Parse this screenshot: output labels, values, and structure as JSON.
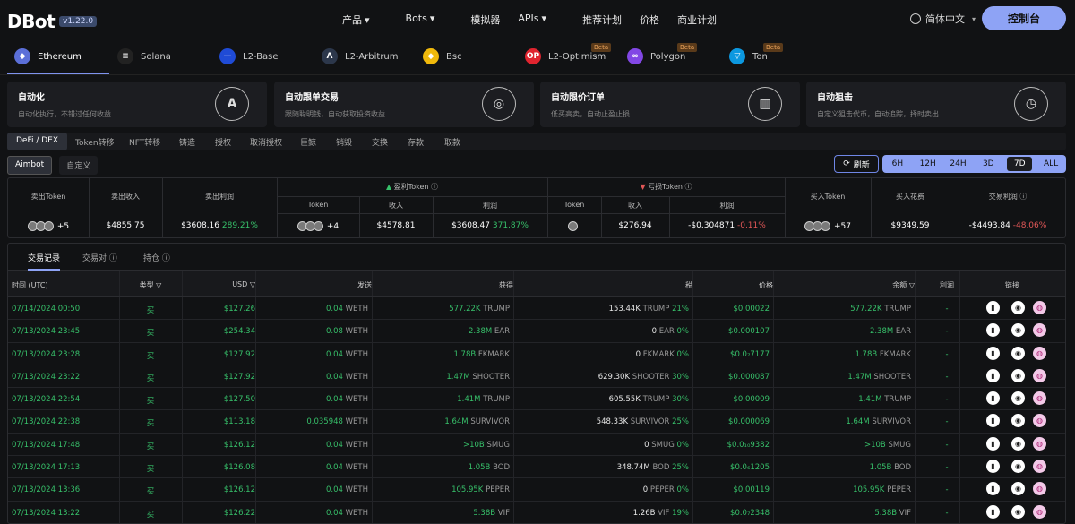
{
  "brand": {
    "name": "DBot",
    "version": "v1.22.0"
  },
  "nav": {
    "items": [
      "产品",
      "Bots",
      "模拟器",
      "APIs",
      "推荐计划",
      "价格",
      "商业计划"
    ],
    "lang": "简体中文",
    "console": "控制台"
  },
  "chains": [
    {
      "label": "Ethereum",
      "color": "#5b6fd8",
      "glyph": "◆",
      "beta": ""
    },
    {
      "label": "Solana",
      "color": "#222",
      "glyph": "≡",
      "beta": ""
    },
    {
      "label": "L2-Base",
      "color": "#1f4bd6",
      "glyph": "—",
      "beta": ""
    },
    {
      "label": "L2-Arbitrum",
      "color": "#2c374b",
      "glyph": "Λ",
      "beta": ""
    },
    {
      "label": "Bsc",
      "color": "#f0b90b",
      "glyph": "◆",
      "beta": ""
    },
    {
      "label": "L2-Optimism",
      "color": "#e0242f",
      "glyph": "OP",
      "beta": "Beta"
    },
    {
      "label": "Polygon",
      "color": "#8247e5",
      "glyph": "∞",
      "beta": "Beta"
    },
    {
      "label": "Ton",
      "color": "#0c98e0",
      "glyph": "▽",
      "beta": "Beta"
    }
  ],
  "cards": [
    {
      "title": "自动化",
      "desc": "自动化执行，不错过任何收益",
      "icon": "A"
    },
    {
      "title": "自动跟单交易",
      "desc": "跟随聪明钱，自动获取投资收益",
      "icon": "◎"
    },
    {
      "title": "自动限价订单",
      "desc": "低买高卖，自动止盈止损",
      "icon": "▥"
    },
    {
      "title": "自动狙击",
      "desc": "自定义狙击代币，自动追踪，择时卖出",
      "icon": "◷"
    }
  ],
  "tabs1": [
    "DeFi / DEX",
    "Token转移",
    "NFT转移",
    "铸造",
    "授权",
    "取消授权",
    "巨鲸",
    "销毁",
    "交换",
    "存款",
    "取款"
  ],
  "tabs2": [
    "Aimbot",
    "自定义"
  ],
  "refresh": "刷新",
  "time": [
    "6H",
    "12H",
    "24H",
    "3D",
    "7D",
    "ALL"
  ],
  "stats": {
    "h": {
      "sell_token": "卖出Token",
      "sell_income": "卖出收入",
      "sell_profit": "卖出利润",
      "profit_token": "盈利Token",
      "loss_token": "亏损Token",
      "token": "Token",
      "income": "收入",
      "profit": "利润",
      "buy_token": "买入Token",
      "buy_cost": "买入花费",
      "trade_profit": "交易利润"
    },
    "v": {
      "sell_token_more": "+5",
      "sell_income": "$4855.75",
      "sell_profit": "$3608.16",
      "sell_profit_pct": "289.21%",
      "p_token_more": "+4",
      "p_income": "$4578.81",
      "p_profit": "$3608.47",
      "p_profit_pct": "371.87%",
      "l_income": "$276.94",
      "l_profit": "-$0.304871",
      "l_profit_pct": "-0.11%",
      "buy_more": "+57",
      "buy_cost": "$9349.59",
      "trade_profit": "-$4493.84",
      "trade_profit_pct": "-48.06%"
    }
  },
  "ttabs": [
    "交易记录",
    "交易对",
    "持仓"
  ],
  "cols": [
    "时间 (UTC)",
    "类型",
    "USD",
    "发送",
    "获得",
    "税",
    "价格",
    "余额",
    "利润",
    "链接"
  ],
  "rows": [
    [
      "07/14/2024 00:50",
      "买",
      "$127.26",
      "0.04",
      "WETH",
      "577.22K",
      "TRUMP",
      "153.44K",
      "TRUMP",
      "21%",
      "$0.00022",
      "577.22K",
      "TRUMP",
      "-"
    ],
    [
      "07/13/2024 23:45",
      "买",
      "$254.34",
      "0.08",
      "WETH",
      "2.38M",
      "EAR",
      "0",
      "EAR",
      "0%",
      "$0.000107",
      "2.38M",
      "EAR",
      "-"
    ],
    [
      "07/13/2024 23:28",
      "买",
      "$127.92",
      "0.04",
      "WETH",
      "1.78B",
      "FKMARK",
      "0",
      "FKMARK",
      "0%",
      "$0.0₇7177",
      "1.78B",
      "FKMARK",
      "-"
    ],
    [
      "07/13/2024 23:22",
      "买",
      "$127.92",
      "0.04",
      "WETH",
      "1.47M",
      "SHOOTER",
      "629.30K",
      "SHOOTER",
      "30%",
      "$0.000087",
      "1.47M",
      "SHOOTER",
      "-"
    ],
    [
      "07/13/2024 22:54",
      "买",
      "$127.50",
      "0.04",
      "WETH",
      "1.41M",
      "TRUMP",
      "605.55K",
      "TRUMP",
      "30%",
      "$0.00009",
      "1.41M",
      "TRUMP",
      "-"
    ],
    [
      "07/13/2024 22:38",
      "买",
      "$113.18",
      "0.035948",
      "WETH",
      "1.64M",
      "SURVIVOR",
      "548.33K",
      "SURVIVOR",
      "25%",
      "$0.000069",
      "1.64M",
      "SURVIVOR",
      "-"
    ],
    [
      "07/13/2024 17:48",
      "买",
      "$126.12",
      "0.04",
      "WETH",
      ">10B",
      "SMUG",
      "0",
      "SMUG",
      "0%",
      "$0.0₁₀9382",
      ">10B",
      "SMUG",
      "-"
    ],
    [
      "07/13/2024 17:13",
      "买",
      "$126.08",
      "0.04",
      "WETH",
      "1.05B",
      "BOD",
      "348.74M",
      "BOD",
      "25%",
      "$0.0₆1205",
      "1.05B",
      "BOD",
      "-"
    ],
    [
      "07/13/2024 13:36",
      "买",
      "$126.12",
      "0.04",
      "WETH",
      "105.95K",
      "PEPER",
      "0",
      "PEPER",
      "0%",
      "$0.00119",
      "105.95K",
      "PEPER",
      "-"
    ],
    [
      "07/13/2024 13:22",
      "买",
      "$126.22",
      "0.04",
      "WETH",
      "5.38B",
      "VIF",
      "1.26B",
      "VIF",
      "19%",
      "$0.0₇2348",
      "5.38B",
      "VIF",
      "-"
    ]
  ]
}
